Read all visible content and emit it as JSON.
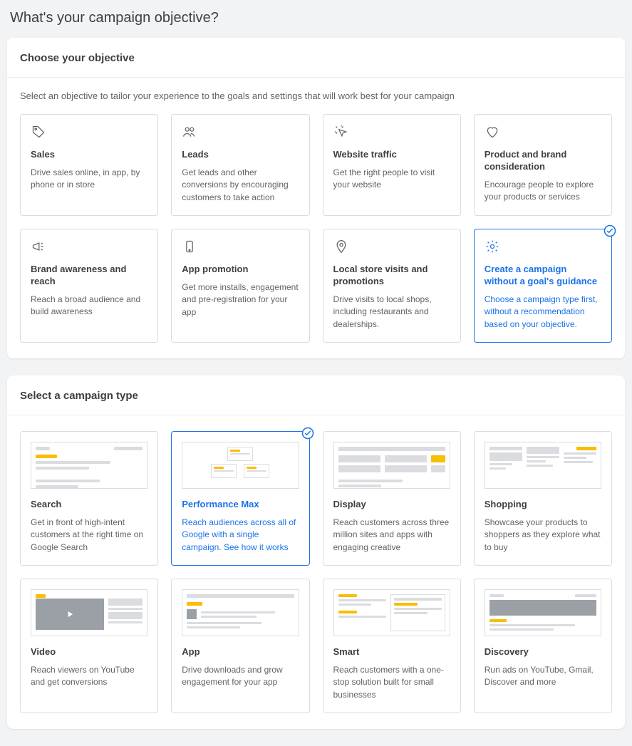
{
  "pageTitle": "What's your campaign objective?",
  "objectivePanel": {
    "header": "Choose your objective",
    "sub": "Select an objective to tailor your experience to the goals and settings that will work best for your campaign",
    "cards": [
      {
        "title": "Sales",
        "desc": "Drive sales online, in app, by phone or in store"
      },
      {
        "title": "Leads",
        "desc": "Get leads and other conversions by encouraging customers to take action"
      },
      {
        "title": "Website traffic",
        "desc": "Get the right people to visit your website"
      },
      {
        "title": "Product and brand consideration",
        "desc": "Encourage people to explore your products or services"
      },
      {
        "title": "Brand awareness and reach",
        "desc": "Reach a broad audience and build awareness"
      },
      {
        "title": "App promotion",
        "desc": "Get more installs, engagement and pre-registration for your app"
      },
      {
        "title": "Local store visits and promotions",
        "desc": "Drive visits to local shops, including restaurants and dealerships."
      },
      {
        "title": "Create a campaign without a goal's guidance",
        "desc": "Choose a campaign type first, without a recommendation based on your objective."
      }
    ]
  },
  "typePanel": {
    "header": "Select a campaign type",
    "cards": [
      {
        "title": "Search",
        "desc": "Get in front of high-intent customers at the right time on Google Search"
      },
      {
        "title": "Performance Max",
        "desc": "Reach audiences across all of Google with a single campaign.",
        "link": "See how it works"
      },
      {
        "title": "Display",
        "desc": "Reach customers across three million sites and apps with engaging creative"
      },
      {
        "title": "Shopping",
        "desc": "Showcase your products to shoppers as they explore what to buy"
      },
      {
        "title": "Video",
        "desc": "Reach viewers on YouTube and get conversions"
      },
      {
        "title": "App",
        "desc": "Drive downloads and grow engagement for your app"
      },
      {
        "title": "Smart",
        "desc": "Reach customers with a one-stop solution built for small businesses"
      },
      {
        "title": "Discovery",
        "desc": "Run ads on YouTube, Gmail, Discover and more"
      }
    ]
  }
}
